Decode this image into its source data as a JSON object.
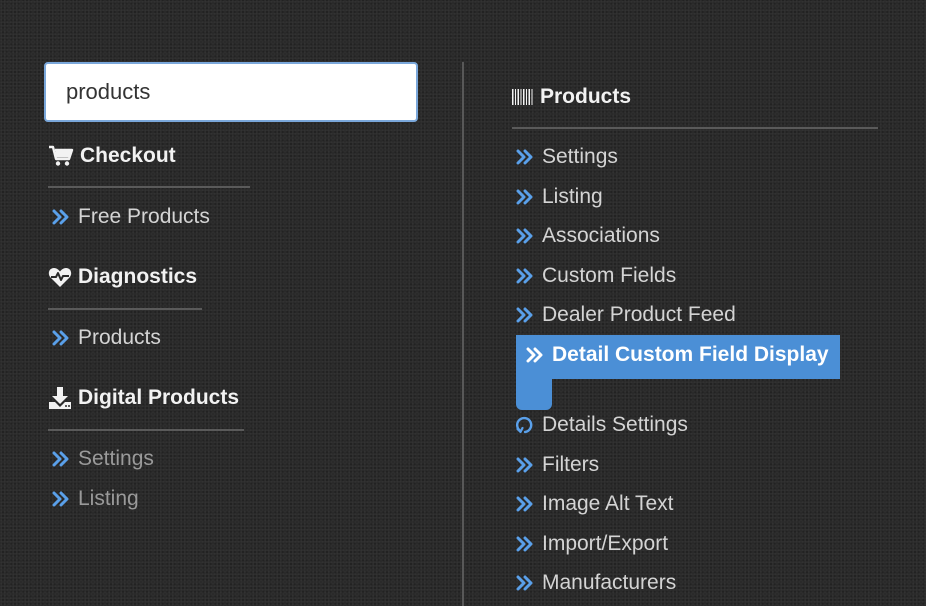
{
  "search": {
    "value": "products"
  },
  "left": {
    "checkout": {
      "title": "Checkout",
      "icon": "shopping-cart-icon",
      "items": [
        "Free Products"
      ]
    },
    "diagnostics": {
      "title": "Diagnostics",
      "icon": "heartbeat-icon",
      "items": [
        "Products"
      ]
    },
    "digital_products": {
      "title": "Digital Products",
      "icon": "download-icon",
      "items": [
        "Settings",
        "Listing"
      ]
    }
  },
  "right": {
    "products": {
      "title": "Products",
      "icon": "barcode-icon",
      "items": [
        "Settings",
        "Listing",
        "Associations",
        "Custom Fields",
        "Dealer Product Feed",
        "Detail Custom Field Display",
        "Details Settings",
        "Filters",
        "Image Alt Text",
        "Import/Export",
        "Manufacturers"
      ],
      "active_index": 5
    }
  },
  "colors": {
    "accent": "#4b8fd6",
    "chevron": "#5aa0ea",
    "background": "#2a2a2a",
    "text": "#d4d4d4"
  }
}
